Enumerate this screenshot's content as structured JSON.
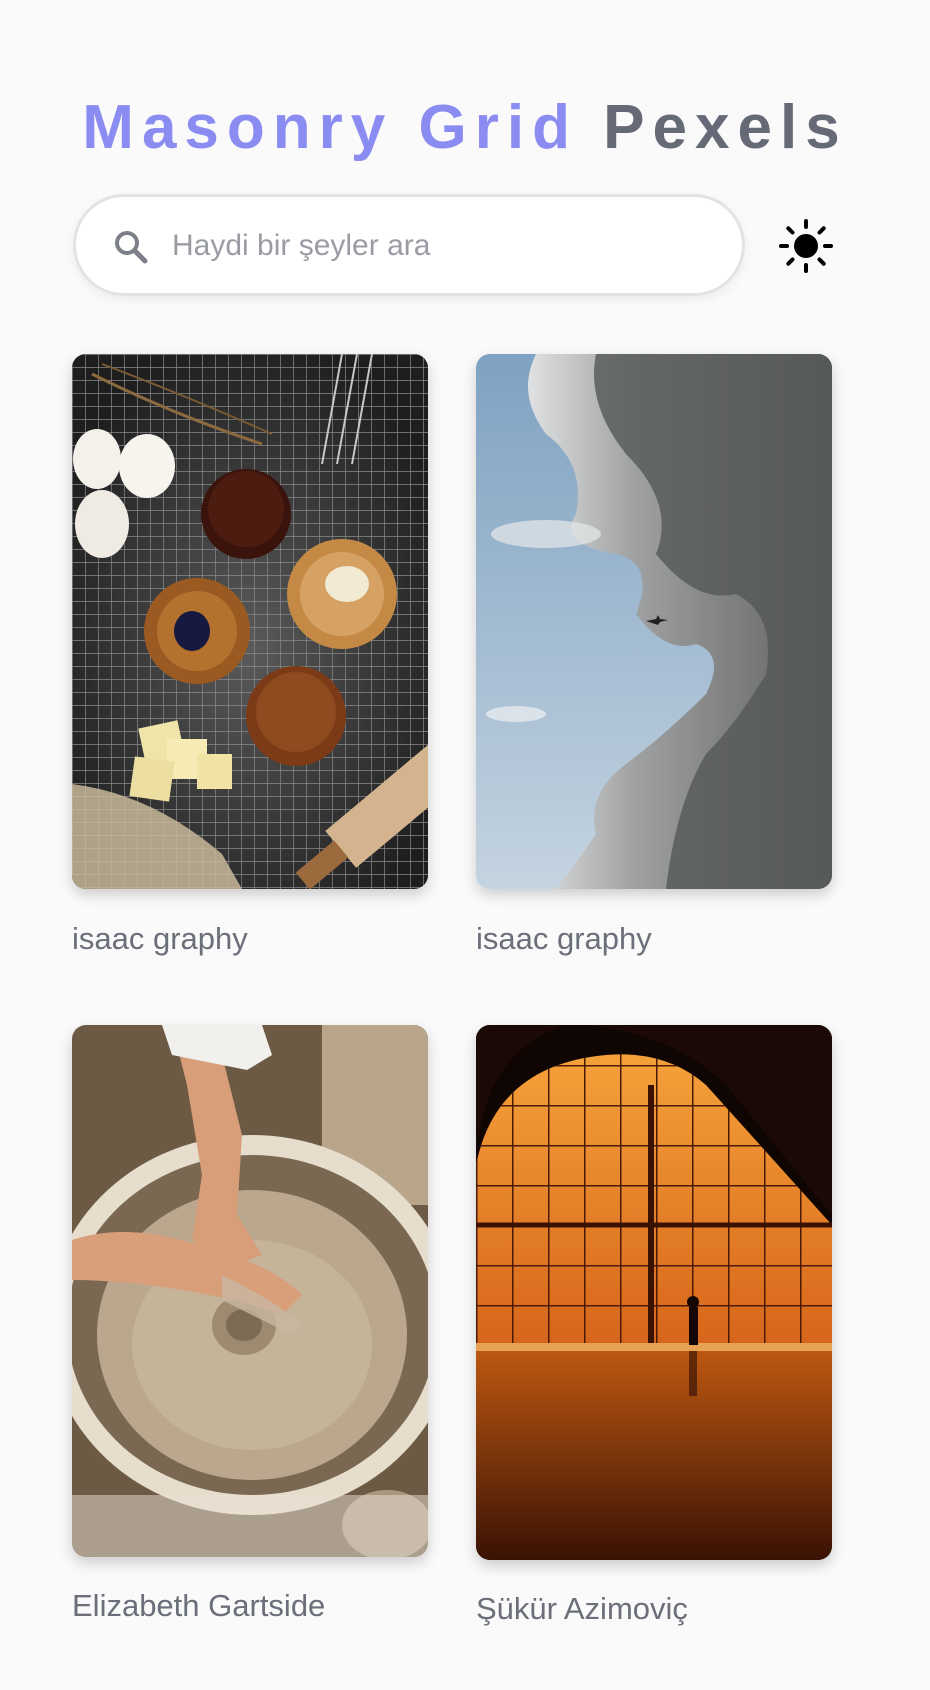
{
  "header": {
    "title_part1": "Masonry Grid",
    "title_part2": "Pexels"
  },
  "search": {
    "placeholder": "Haydi bir şeyler ara",
    "value": "",
    "icon": "search-icon"
  },
  "theme_toggle": {
    "icon": "sun-icon"
  },
  "colors": {
    "title_accent": "#8b8cf2",
    "title_secondary": "#666a76",
    "author_text": "#6b6f7a",
    "background": "#fafafa"
  },
  "photos": [
    {
      "author": "isaac graphy"
    },
    {
      "author": "isaac graphy"
    },
    {
      "author": "Elizabeth Gartside"
    },
    {
      "author": "Şükür Azimoviç"
    }
  ]
}
